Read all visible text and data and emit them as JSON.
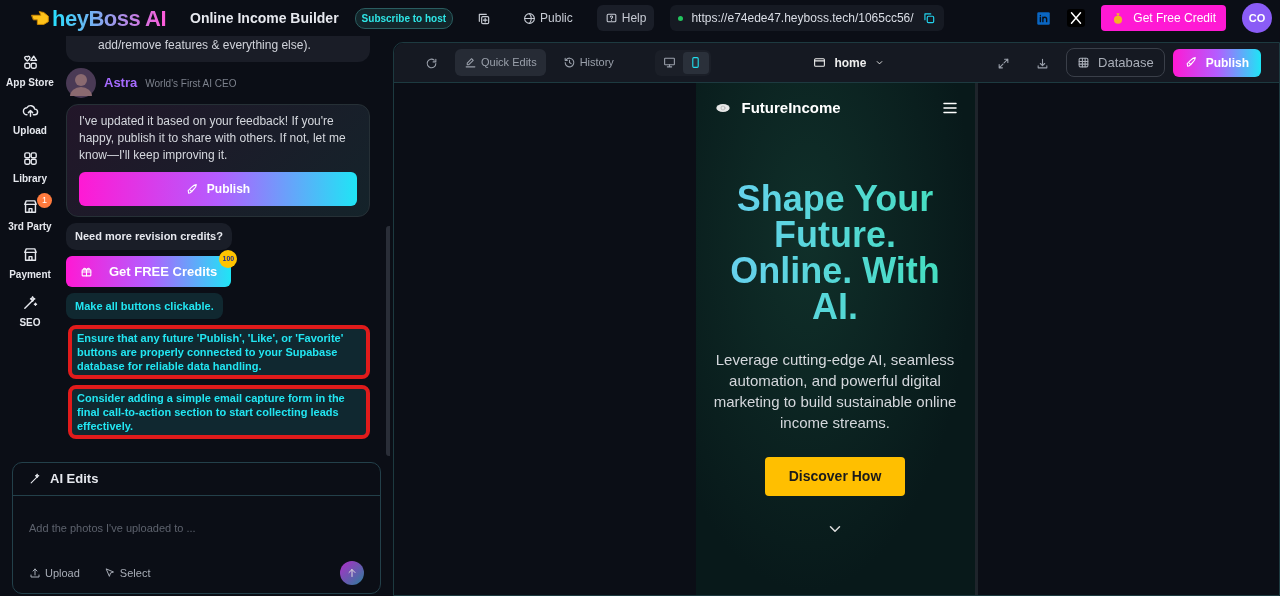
{
  "app": {
    "logo": "heyBoss AI",
    "project_title": "Online Income Builder",
    "subscribe_label": "Subscribe to host",
    "visibility": "Public",
    "help": "Help",
    "url": "https://e74ede47.heyboss.tech/1065cc56/",
    "get_credit": "Get Free Credit",
    "avatar": "CO"
  },
  "rail": [
    {
      "label": "App Store"
    },
    {
      "label": "Upload"
    },
    {
      "label": "Library"
    },
    {
      "label": "3rd Party",
      "badge": "1"
    },
    {
      "label": "Payment"
    },
    {
      "label": "SEO"
    }
  ],
  "chat": {
    "truncated_message": "add/remove features & everything else).",
    "agent": {
      "name": "Astra",
      "tagline": "World's First AI CEO"
    },
    "reply": "I've updated it based on your feedback! If you're happy, publish it to share with others. If not, let me know—I'll keep improving it.",
    "publish": "Publish",
    "credits_prompt": "Need more revision credits?",
    "credits_button": "Get FREE Credits",
    "credits_badge": "100",
    "suggestions": [
      {
        "text": "Make all buttons clickable.",
        "highlighted": false
      },
      {
        "text": "Ensure that any future 'Publish', 'Like', or 'Favorite' buttons are properly connected to your Supabase database for reliable data handling.",
        "highlighted": true
      },
      {
        "text": "Consider adding a simple email capture form in the final call-to-action section to start collecting leads effectively.",
        "highlighted": true
      }
    ]
  },
  "ai_edits": {
    "title": "AI Edits",
    "placeholder": "Add the photos I've uploaded to ...",
    "upload": "Upload",
    "select": "Select"
  },
  "preview": {
    "modes": [
      {
        "label": "Quick Edits",
        "selected": true
      },
      {
        "label": "History",
        "selected": false
      }
    ],
    "devices": [
      {
        "kind": "desktop",
        "selected": false
      },
      {
        "kind": "mobile",
        "selected": true
      }
    ],
    "page": "home",
    "database": "Database",
    "publish": "Publish",
    "site": {
      "brand": "FutureIncome",
      "headline": "Shape Your Future. Online. With AI.",
      "subtitle": "Leverage cutting-edge AI, seamless automation, and powerful digital marketing to build sustainable online income streams.",
      "cta": "Discover How"
    }
  }
}
